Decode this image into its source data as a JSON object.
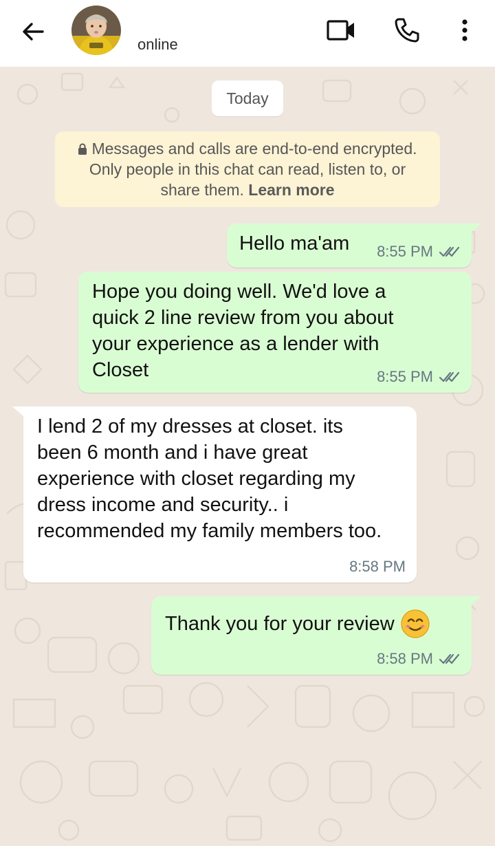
{
  "header": {
    "status": "online"
  },
  "chat": {
    "date_chip": "Today",
    "notice": {
      "text": "Messages and calls are end-to-end encrypted. Only people in this chat can read, listen to, or share them.",
      "link": "Learn more"
    },
    "messages": [
      {
        "direction": "outgoing",
        "text": "Hello ma'am",
        "time": "8:55 PM",
        "status": "read"
      },
      {
        "direction": "outgoing",
        "text": "Hope you doing well. We'd love a quick 2 line review from you about your experience as a lender with Closet",
        "time": "8:55 PM",
        "status": "read"
      },
      {
        "direction": "incoming",
        "text": "I lend 2 of my dresses at closet. its been 6 month and i have great experience with closet regarding my dress income and security.. i recommended my family members too.",
        "time": "8:58 PM"
      },
      {
        "direction": "outgoing",
        "text": "Thank you for your review",
        "emoji": "smiling-face",
        "time": "8:58 PM",
        "status": "read"
      }
    ]
  },
  "colors": {
    "outgoing_bubble": "#d9fdd3",
    "incoming_bubble": "#ffffff",
    "chat_background": "#efe7de",
    "notice_background": "#fdf3d5",
    "read_ticks": "#667781"
  },
  "icons": [
    "back-arrow-icon",
    "video-call-icon",
    "phone-icon",
    "more-vert-icon",
    "lock-icon",
    "double-check-icon",
    "smiling-face-emoji"
  ]
}
